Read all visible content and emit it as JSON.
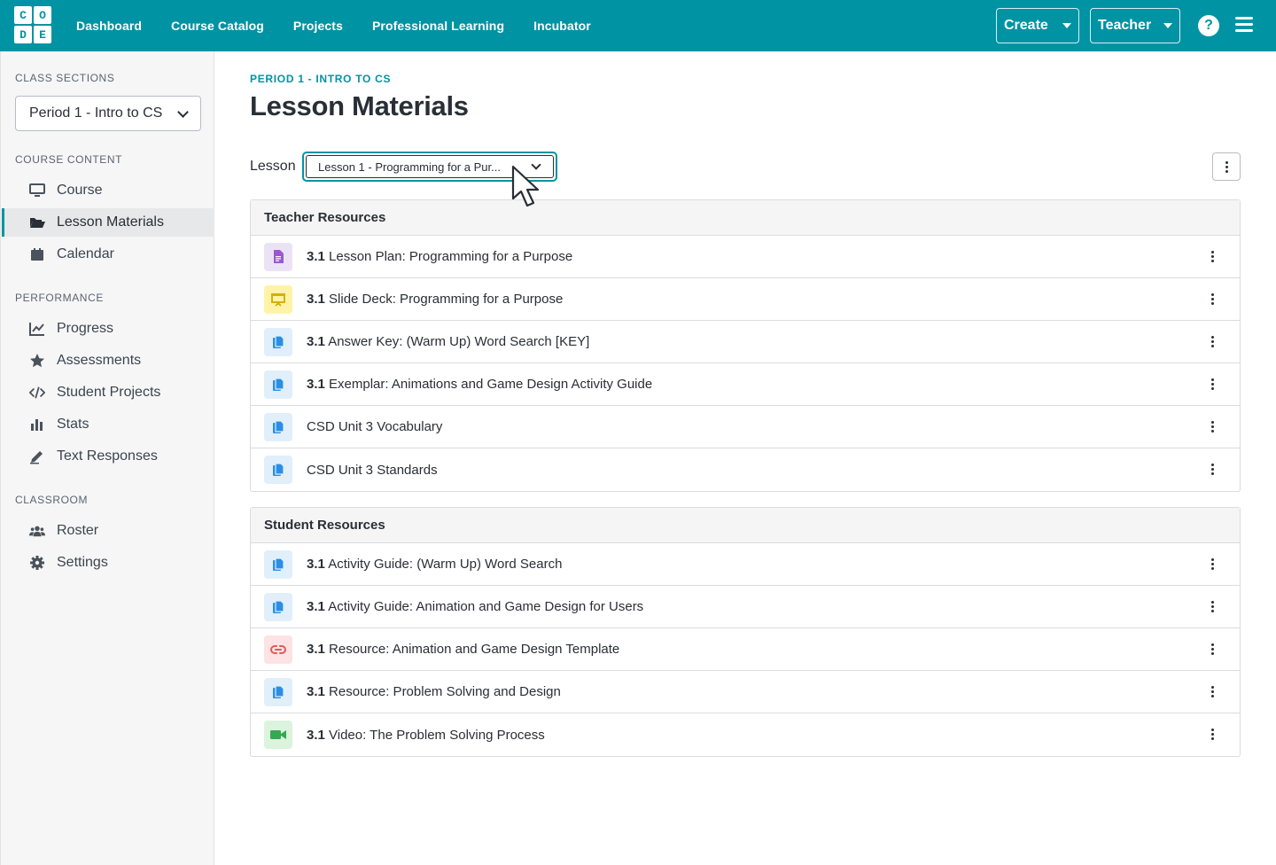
{
  "nav": {
    "logo": [
      "C",
      "O",
      "D",
      "E"
    ],
    "links": [
      "Dashboard",
      "Course Catalog",
      "Projects",
      "Professional Learning",
      "Incubator"
    ],
    "create_label": "Create",
    "teacher_label": "Teacher",
    "help_glyph": "?"
  },
  "sidebar": {
    "class_sections_heading": "CLASS SECTIONS",
    "section_value": "Period 1 - Intro to CS",
    "course_content_heading": "COURSE CONTENT",
    "performance_heading": "PERFORMANCE",
    "classroom_heading": "CLASSROOM",
    "items": {
      "course": "Course",
      "lesson_materials": "Lesson Materials",
      "calendar": "Calendar",
      "progress": "Progress",
      "assessments": "Assessments",
      "student_projects": "Student Projects",
      "stats": "Stats",
      "text_responses": "Text Responses",
      "roster": "Roster",
      "settings": "Settings"
    }
  },
  "main": {
    "breadcrumb": "PERIOD 1 - INTRO TO CS",
    "title": "Lesson Materials",
    "lesson_label": "Lesson",
    "lesson_value": "Lesson 1 - Programming for a Pur...",
    "teacher_heading": "Teacher Resources",
    "teacher_rows": [
      {
        "num": "3.1",
        "text": " Lesson Plan: Programming for a Purpose",
        "icon": "lesson-plan-icon"
      },
      {
        "num": "3.1",
        "text": " Slide Deck: Programming for a Purpose",
        "icon": "slide-deck-icon"
      },
      {
        "num": "3.1",
        "text": " Answer Key: (Warm Up) Word Search [KEY]",
        "icon": "copy-doc-icon"
      },
      {
        "num": "3.1",
        "text": " Exemplar: Animations and Game Design Activity Guide",
        "icon": "copy-doc-icon"
      },
      {
        "num": "",
        "text": "CSD Unit 3 Vocabulary",
        "icon": "copy-doc-icon"
      },
      {
        "num": "",
        "text": "CSD Unit 3 Standards",
        "icon": "copy-doc-icon"
      }
    ],
    "student_heading": "Student Resources",
    "student_rows": [
      {
        "num": "3.1",
        "text": " Activity Guide: (Warm Up) Word Search",
        "icon": "copy-doc-icon"
      },
      {
        "num": "3.1",
        "text": " Activity Guide: Animation and Game Design for Users",
        "icon": "copy-doc-icon"
      },
      {
        "num": "3.1",
        "text": " Resource: Animation and Game Design Template",
        "icon": "link-icon"
      },
      {
        "num": "3.1",
        "text": " Resource: Problem Solving and Design",
        "icon": "copy-doc-icon"
      },
      {
        "num": "3.1",
        "text": " Video: The Problem Solving Process",
        "icon": "video-icon"
      }
    ]
  },
  "colors": {
    "brand": "#0093a4",
    "doc_purple": "#9b59d0",
    "slide_yellow": "#d4b100",
    "copy_blue": "#2b8ee6",
    "link_red": "#e05a5a",
    "video_green": "#34a853"
  }
}
